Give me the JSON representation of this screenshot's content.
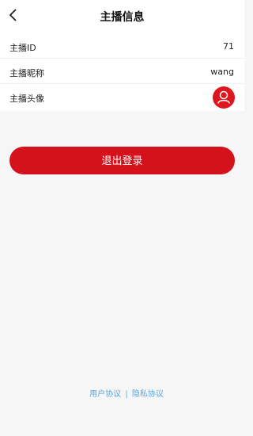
{
  "header": {
    "title": "主播信息",
    "back_icon": "chevron-left-icon"
  },
  "rows": [
    {
      "label": "主播ID",
      "value": "71"
    },
    {
      "label": "主播昵称",
      "value": "wang"
    },
    {
      "label": "主播头像",
      "value_icon": "user-avatar-icon"
    }
  ],
  "logout": {
    "label": "退出登录",
    "color": "#d4121b"
  },
  "footer": {
    "user_agreement": "用户协议",
    "separator": "|",
    "privacy_agreement": "隐私协议",
    "link_color": "#57a8dc"
  }
}
